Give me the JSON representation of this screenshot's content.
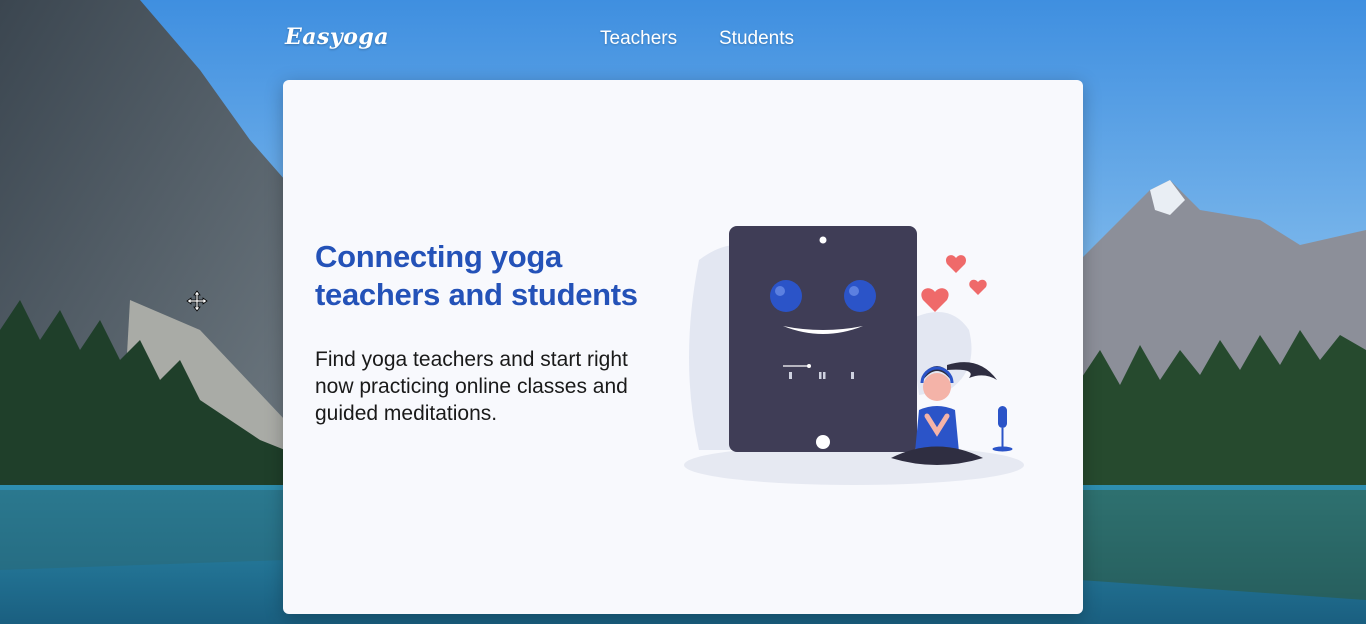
{
  "header": {
    "logo_text": "Easyoga",
    "nav": [
      {
        "label": "Teachers"
      },
      {
        "label": "Students"
      }
    ]
  },
  "hero": {
    "headline": "Connecting yoga teachers and students",
    "description": "Find yoga teachers and start right now practicing online classes and guided meditations."
  },
  "colors": {
    "accent": "#2452b8",
    "card_background": "#f8f9fd",
    "tablet_screen": "#3f3d56",
    "heart": "#ef6a6a"
  },
  "icons": {
    "cursor": "move-cursor-icon"
  }
}
